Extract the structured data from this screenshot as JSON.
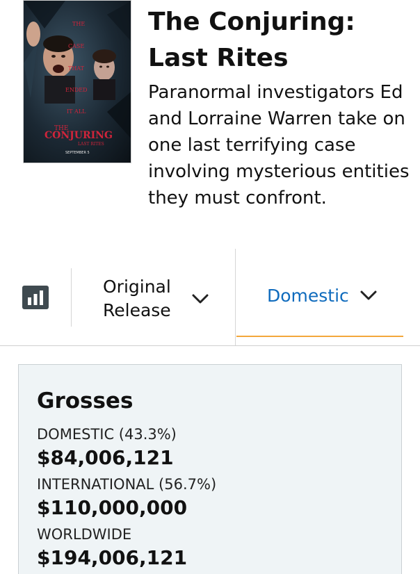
{
  "movie": {
    "title": "The Conjuring: Last Rites",
    "synopsis": "Paranormal investigators Ed and Lorraine Warren take on one last terrifying case involving mysterious entities they must confront.",
    "poster": {
      "tagline_words": [
        "THE",
        "CASE",
        "THAT",
        "ENDED",
        "IT ALL"
      ],
      "logo_line1": "THE",
      "logo_line2": "CONJURING",
      "logo_line3": "LAST RITES",
      "release_line": "SEPTEMBER 5"
    }
  },
  "tabs": {
    "chart_icon": "bar-chart-icon",
    "release_select": {
      "label": "Original Release"
    },
    "domestic": {
      "label": "Domestic",
      "accent_color": "#f3a73b",
      "text_color": "#0f6bbd"
    }
  },
  "grosses": {
    "title": "Grosses",
    "rows": [
      {
        "label": "DOMESTIC (43.3%)",
        "value": "$84,006,121"
      },
      {
        "label": "INTERNATIONAL (56.7%)",
        "value": "$110,000,000"
      },
      {
        "label": "WORLDWIDE",
        "value": "$194,006,121"
      }
    ]
  }
}
